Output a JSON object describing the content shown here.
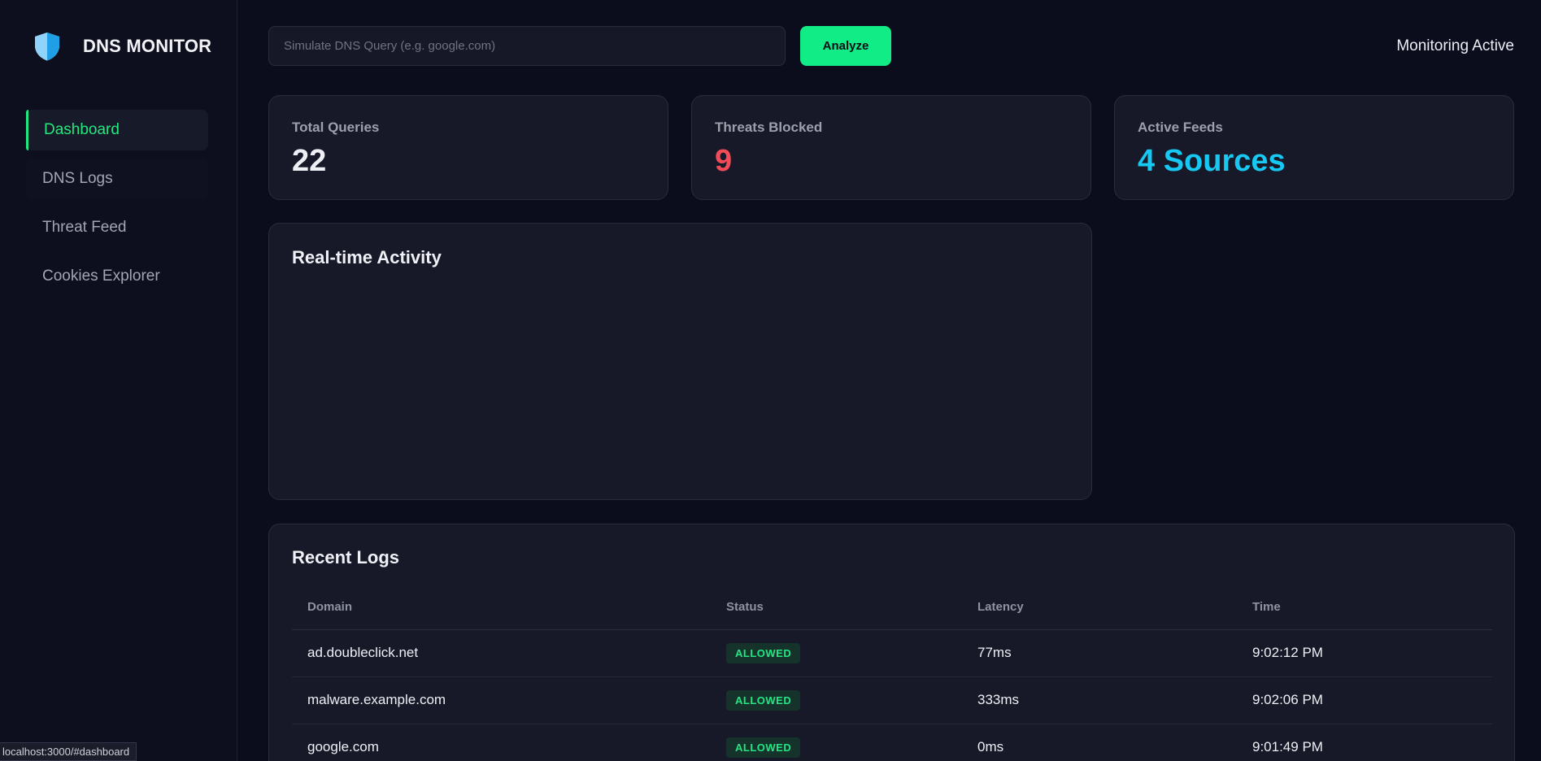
{
  "app": {
    "title": "DNS MONITOR"
  },
  "sidebar": {
    "items": [
      {
        "label": "Dashboard",
        "active": true
      },
      {
        "label": "DNS Logs"
      },
      {
        "label": "Threat Feed"
      },
      {
        "label": "Cookies Explorer"
      }
    ]
  },
  "topbar": {
    "search_placeholder": "Simulate DNS Query (e.g. google.com)",
    "search_value": "",
    "analyze_label": "Analyze",
    "status_text": "Monitoring Active"
  },
  "stats": [
    {
      "label": "Total Queries",
      "value": "22",
      "color": "#eef0f5"
    },
    {
      "label": "Threats Blocked",
      "value": "9",
      "color": "#f04b57"
    },
    {
      "label": "Active Feeds",
      "value": "4 Sources",
      "color": "#16c8f2"
    }
  ],
  "activity": {
    "title": "Real-time Activity"
  },
  "logs": {
    "title": "Recent Logs",
    "columns": [
      "Domain",
      "Status",
      "Latency",
      "Time"
    ],
    "rows": [
      {
        "domain": "ad.doubleclick.net",
        "status": "ALLOWED",
        "latency": "77ms",
        "time": "9:02:12 PM"
      },
      {
        "domain": "malware.example.com",
        "status": "ALLOWED",
        "latency": "333ms",
        "time": "9:02:06 PM"
      },
      {
        "domain": "google.com",
        "status": "ALLOWED",
        "latency": "0ms",
        "time": "9:01:49 PM"
      }
    ]
  },
  "statusbar": {
    "url": "localhost:3000/#dashboard"
  },
  "colors": {
    "accent": "#12ec86",
    "danger": "#f04b57",
    "info": "#16c8f2"
  },
  "icons": {
    "brand": "shield-icon"
  }
}
